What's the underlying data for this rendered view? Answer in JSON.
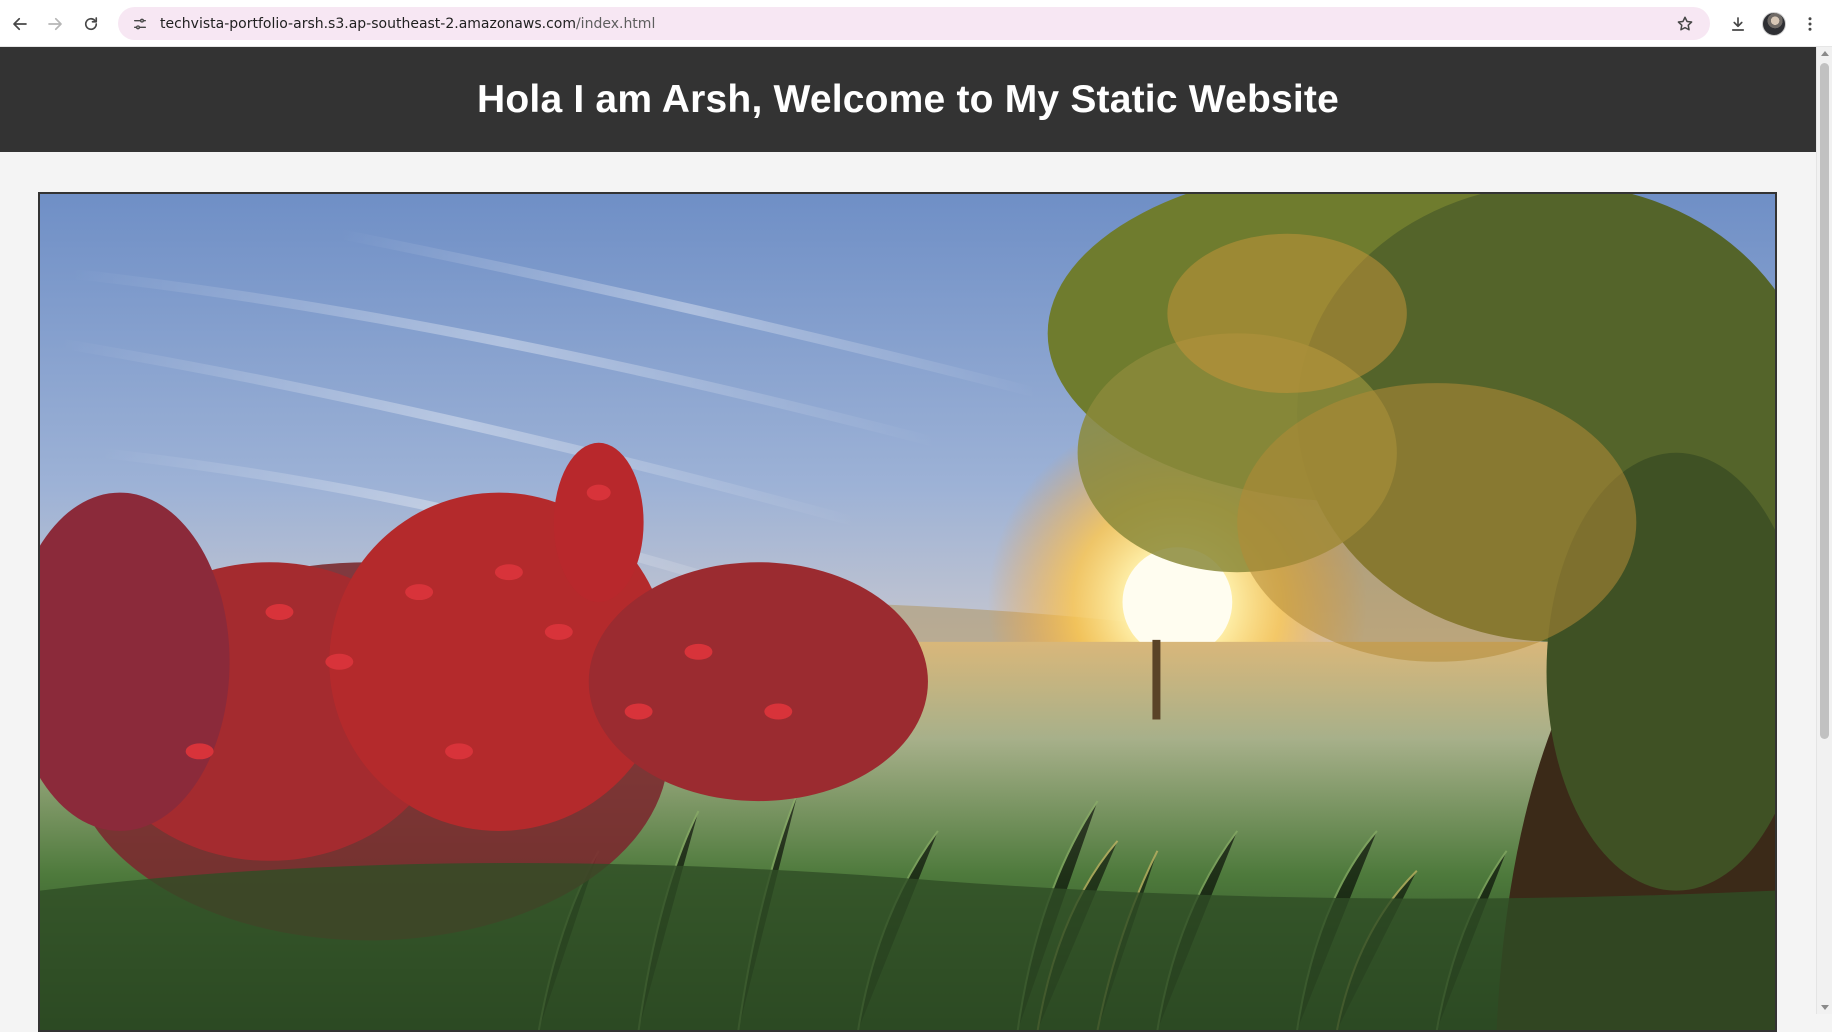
{
  "browser": {
    "url_host": "techvista-portfolio-arsh.s3.ap-southeast-2.amazonaws.com",
    "url_path": "/index.html",
    "icons": {
      "back": "back-arrow-icon",
      "forward": "forward-arrow-icon",
      "reload": "reload-icon",
      "site_info": "site-info-icon",
      "bookmark": "star-icon",
      "download": "download-icon",
      "profile": "avatar",
      "menu": "kebab-menu-icon"
    },
    "omnibox_color": "#f7e7f3"
  },
  "page": {
    "title": "Hola I am Arsh, Welcome to My Static Website",
    "header_bg": "#333333",
    "body_bg": "#f4f4f4",
    "hero_image": "sunrise meadow with red leafy bushes, frosted grass and a tree"
  }
}
